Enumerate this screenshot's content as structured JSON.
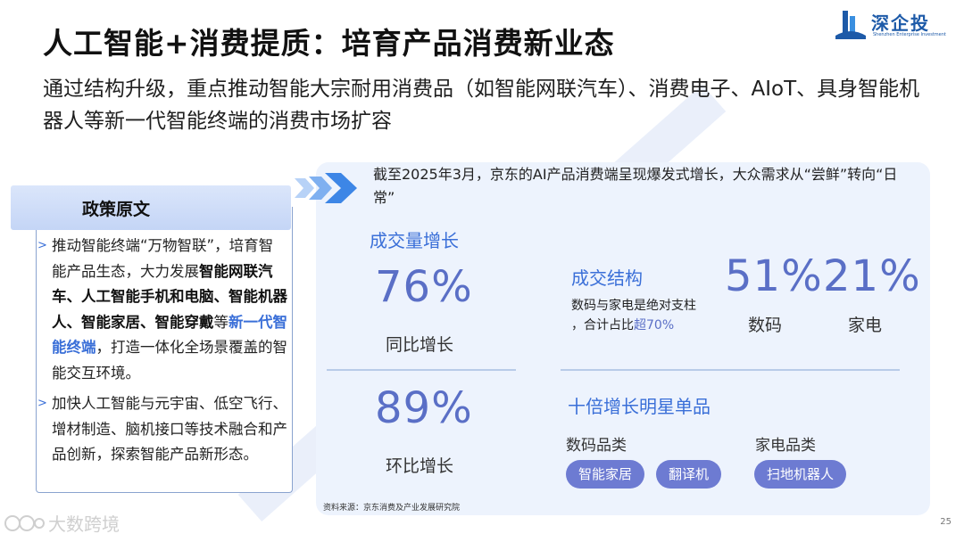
{
  "header": {
    "title": "人工智能+消费提质：培育产品消费新业态",
    "subtitle": "通过结构升级，重点推动智能大宗耐用消费品（如智能网联汽车）、消费电子、AIoT、具身智能机器人等新一代智能终端的消费市场扩容"
  },
  "logo": {
    "name": "深企投",
    "english": "Shenzhen Enterprise Investment"
  },
  "policy": {
    "heading": "政策原文",
    "bullet1": {
      "marker": ">",
      "t1": "推动智能终端“万物智联”，培育智能产品生态，大力发展",
      "b1": "智能网联汽车、人工智能手机和电脑、智能机器人、智能家居、智能穿戴",
      "t2": "等",
      "hl": "新一代智能终端",
      "t3": "，打造一体化全场景覆盖的智能交互环境。"
    },
    "bullet2": {
      "marker": ">",
      "text": "加快人工智能与元宇宙、低空飞行、增材制造、脑机接口等技术融合和产品创新，探索智能产品新形态。"
    }
  },
  "panel": {
    "intro": "截至2025年3月，京东的AI产品消费端呈现爆发式增长，大众需求从“尝鲜”转向“日常”",
    "volume": {
      "title": "成交量增长",
      "yoy_value": "76%",
      "yoy_label": "同比增长",
      "mom_value": "89%",
      "mom_label": "环比增长"
    },
    "structure": {
      "title": "成交结构",
      "desc_line1": "数码与家电是绝对支柱",
      "desc_line2_a": "，合计占比",
      "desc_line2_b": "超70%",
      "digital_value": "51%",
      "digital_label": "数码",
      "appliance_value": "21%",
      "appliance_label": "家电"
    },
    "stars": {
      "title": "十倍增长明星单品",
      "digital_category": "数码品类",
      "appliance_category": "家电品类",
      "items_digital": [
        "智能家居",
        "翻译机"
      ],
      "items_appliance": [
        "扫地机器人"
      ]
    },
    "source": "资料来源：京东消费及产业发展研究院"
  },
  "footer": {
    "page_number": "25",
    "watermark": "大数跨境"
  },
  "colors": {
    "accent": "#3a6fd8",
    "number": "#5a6fc6",
    "pill": "#6d7bd2",
    "panel_bg": "#edf3fd"
  }
}
